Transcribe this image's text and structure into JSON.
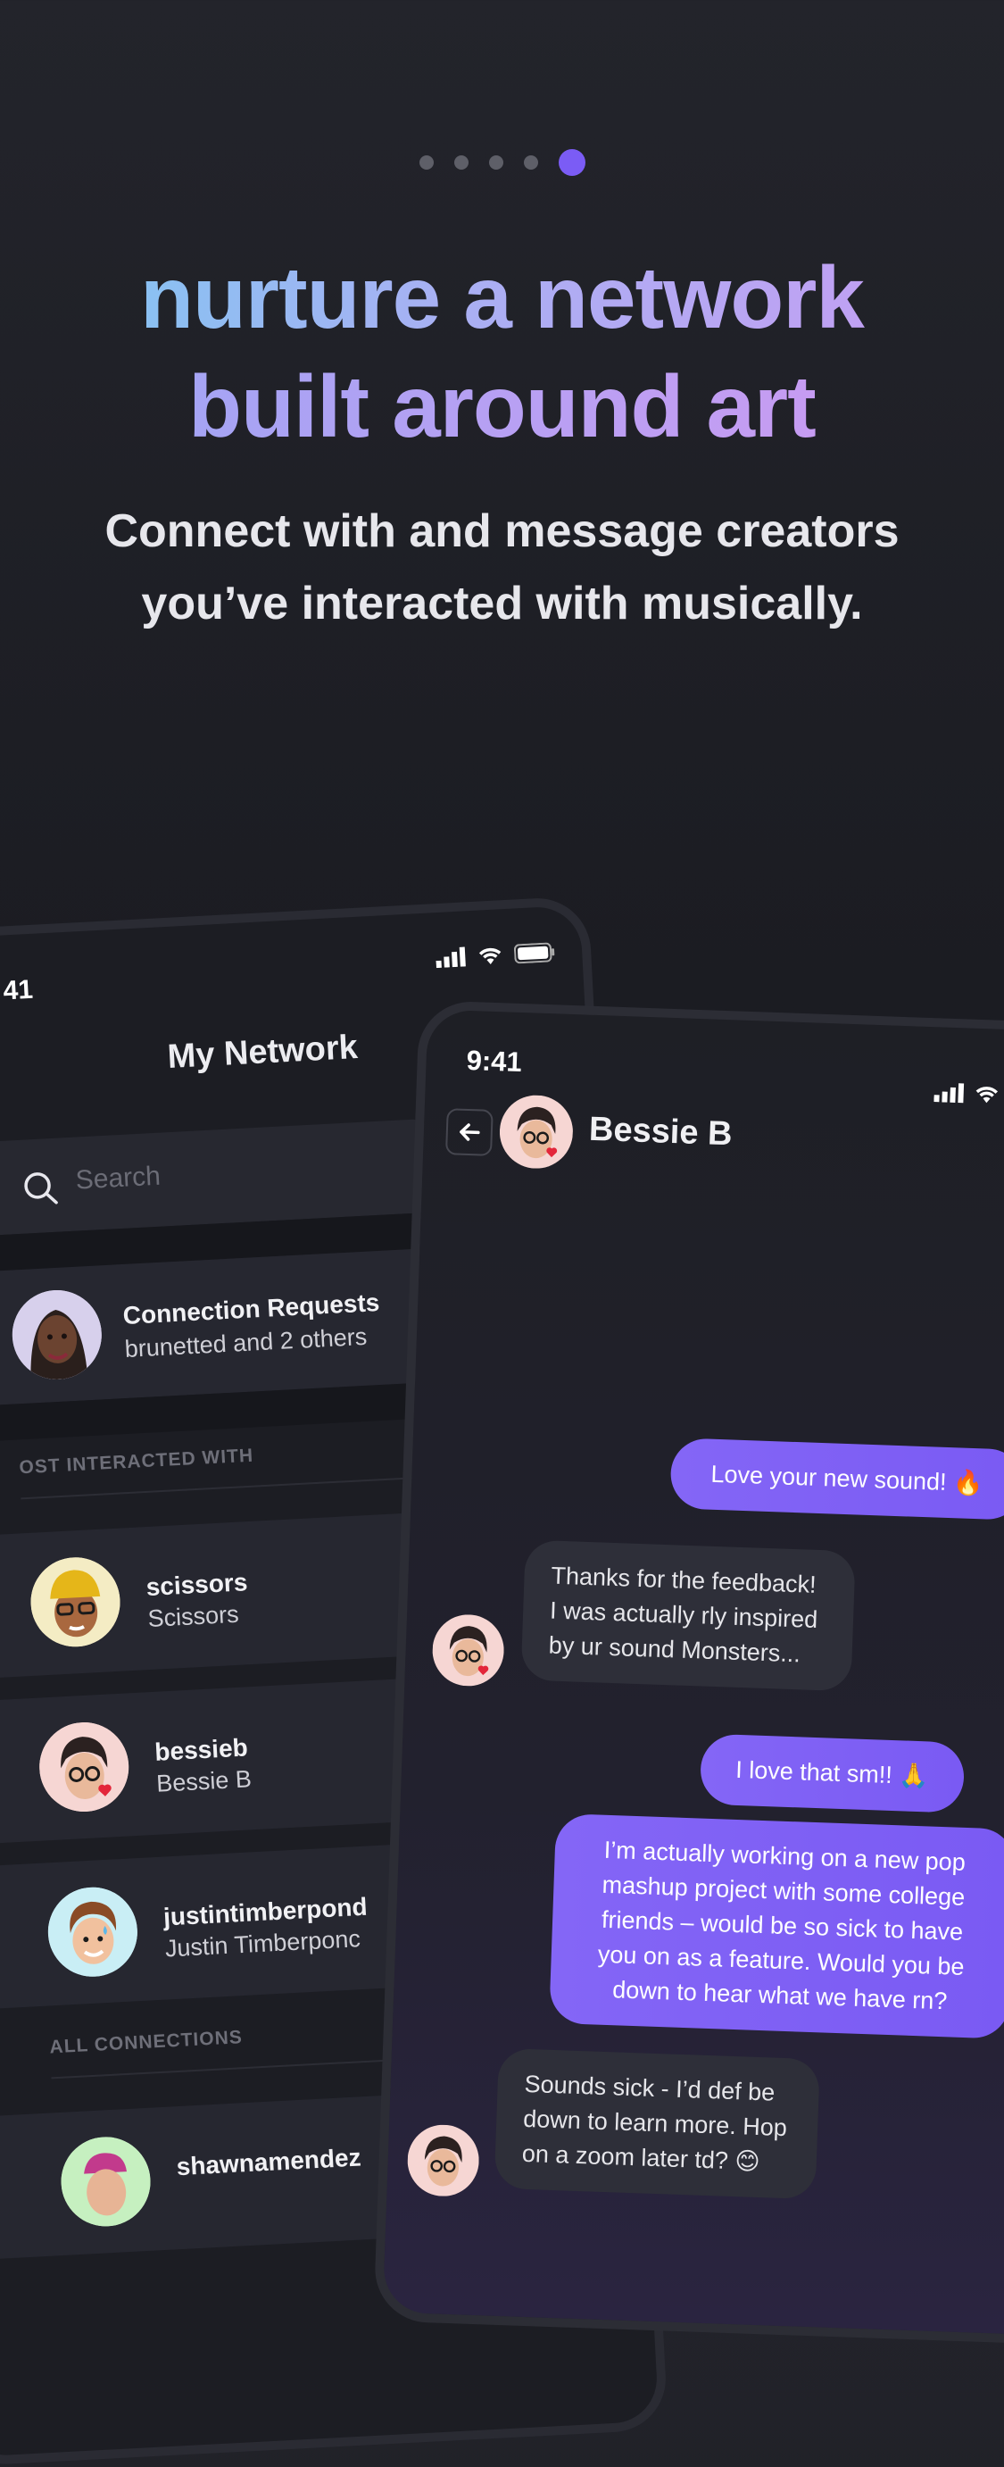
{
  "pagination": {
    "total": 5,
    "active_index": 4
  },
  "headline": {
    "line1": "nurture a network",
    "line2": "built around art"
  },
  "subtitle": {
    "line1": "Connect with and message creators",
    "line2": "you’ve interacted with musically."
  },
  "network_screen": {
    "time": "41",
    "title": "My Network",
    "search_placeholder": "Search",
    "connection_requests": {
      "title": "Connection Requests",
      "subtitle": "brunetted and 2 others"
    },
    "section_most": "OST INTERACTED WITH",
    "section_all": "ALL CONNECTIONS",
    "contacts": [
      {
        "username": "scissors",
        "name": "Scissors"
      },
      {
        "username": "bessieb",
        "name": "Bessie B"
      },
      {
        "username": "justintimberpond",
        "name": "Justin Timberponc"
      },
      {
        "username": "shawnamendez",
        "name": ""
      }
    ]
  },
  "chat_screen": {
    "time": "9:41",
    "contact_name": "Bessie B",
    "messages": [
      {
        "from": "me",
        "lines": [
          "Love your new sound! 🔥"
        ]
      },
      {
        "from": "them",
        "lines": [
          "Thanks for the feedback!",
          "I was actually rly inspired",
          "by ur sound Monsters..."
        ]
      },
      {
        "from": "me",
        "lines": [
          "I love that sm!! 🙏"
        ]
      },
      {
        "from": "me",
        "lines": [
          "I’m actually working on a new pop",
          "mashup project with some college",
          "friends – would be so sick to have",
          "you on as a feature. Would you be",
          "down to hear what we have rn?"
        ]
      },
      {
        "from": "them",
        "lines": [
          "Sounds sick - I’d def be",
          "down to learn more. Hop",
          "on a zoom later td? 😊"
        ]
      }
    ]
  },
  "colors": {
    "accent": "#7b5cf5",
    "background": "#1b1c22",
    "card": "#262730"
  }
}
